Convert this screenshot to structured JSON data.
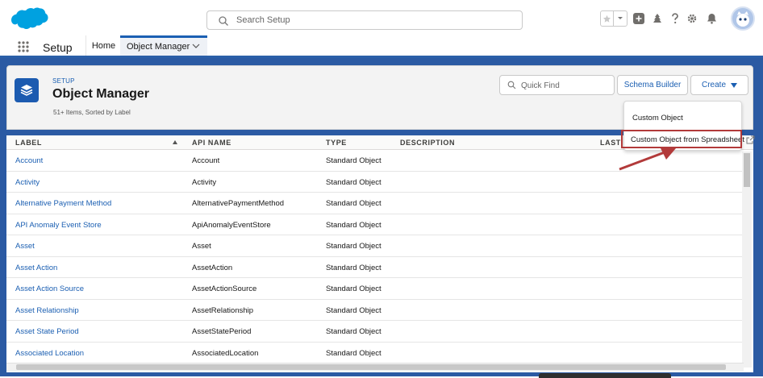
{
  "header": {
    "search_placeholder": "Search Setup"
  },
  "context_bar": {
    "app_name": "Setup",
    "tabs": [
      {
        "label": "Home"
      },
      {
        "label": "Object Manager"
      }
    ]
  },
  "page_header": {
    "breadcrumb": "SETUP",
    "title": "Object Manager",
    "item_count": "51+ Items, Sorted by Label",
    "quick_find_placeholder": "Quick Find",
    "schema_builder_label": "Schema Builder",
    "create_label": "Create"
  },
  "create_menu": {
    "items": [
      {
        "label": "Custom Object"
      },
      {
        "label": "Custom Object from Spreadsheet"
      }
    ]
  },
  "table": {
    "columns": [
      "LABEL",
      "API NAME",
      "TYPE",
      "DESCRIPTION",
      "LAST"
    ],
    "rows": [
      {
        "label": "Account",
        "api_name": "Account",
        "type": "Standard Object"
      },
      {
        "label": "Activity",
        "api_name": "Activity",
        "type": "Standard Object"
      },
      {
        "label": "Alternative Payment Method",
        "api_name": "AlternativePaymentMethod",
        "type": "Standard Object"
      },
      {
        "label": "API Anomaly Event Store",
        "api_name": "ApiAnomalyEventStore",
        "type": "Standard Object"
      },
      {
        "label": "Asset",
        "api_name": "Asset",
        "type": "Standard Object"
      },
      {
        "label": "Asset Action",
        "api_name": "AssetAction",
        "type": "Standard Object"
      },
      {
        "label": "Asset Action Source",
        "api_name": "AssetActionSource",
        "type": "Standard Object"
      },
      {
        "label": "Asset Relationship",
        "api_name": "AssetRelationship",
        "type": "Standard Object"
      },
      {
        "label": "Asset State Period",
        "api_name": "AssetStatePeriod",
        "type": "Standard Object"
      },
      {
        "label": "Associated Location",
        "api_name": "AssociatedLocation",
        "type": "Standard Object"
      }
    ]
  },
  "colors": {
    "brand_blue": "#1b5fb2",
    "band_blue": "#2b5aa3",
    "logo_blue": "#00a1e0",
    "annotation_red": "#b23a3a"
  }
}
